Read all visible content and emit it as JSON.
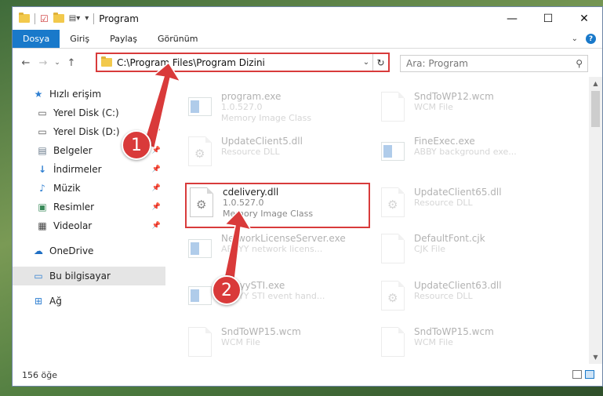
{
  "window": {
    "title": "Program"
  },
  "ribbon": {
    "tabs": [
      "Dosya",
      "Giriş",
      "Paylaş",
      "Görünüm"
    ]
  },
  "address": {
    "path": "C:\\Program Files\\Program Dizini"
  },
  "search": {
    "placeholder": "Ara: Program"
  },
  "sidebar": {
    "items": [
      {
        "label": "Hızlı erişim"
      },
      {
        "label": "Yerel Disk (C:)"
      },
      {
        "label": "Yerel Disk (D:)"
      },
      {
        "label": "Belgeler"
      },
      {
        "label": "İndirmeler"
      },
      {
        "label": "Müzik"
      },
      {
        "label": "Resimler"
      },
      {
        "label": "Videolar"
      },
      {
        "label": "OneDrive"
      },
      {
        "label": "Bu bilgisayar"
      },
      {
        "label": "Ağ"
      }
    ]
  },
  "files": [
    {
      "name": "program.exe",
      "line2": "1.0.527.0",
      "line3": "Memory Image Class"
    },
    {
      "name": "SndToWP12.wcm",
      "line2": "WCM File",
      "line3": ""
    },
    {
      "name": "UpdateClient5.dll",
      "line2": "Resource DLL",
      "line3": ""
    },
    {
      "name": "FineExec.exe",
      "line2": "ABBY background exe...",
      "line3": ""
    },
    {
      "name": "cdelivery.dll",
      "line2": "1.0.527.0",
      "line3": "Memory Image Class"
    },
    {
      "name": "UpdateClient65.dll",
      "line2": "Resource DLL",
      "line3": ""
    },
    {
      "name": "NetworkLicenseServer.exe",
      "line2": "ABBYY network licens...",
      "line3": ""
    },
    {
      "name": "DefaultFont.cjk",
      "line2": "CJK File",
      "line3": ""
    },
    {
      "name": "AbbyySTI.exe",
      "line2": "ABBYY STI event hand...",
      "line3": ""
    },
    {
      "name": "UpdateClient63.dll",
      "line2": "Resource DLL",
      "line3": ""
    },
    {
      "name": "SndToWP15.wcm",
      "line2": "WCM File",
      "line3": ""
    },
    {
      "name": "SndToWP15.wcm",
      "line2": "WCM File",
      "line3": ""
    }
  ],
  "status": {
    "count": "156 öğe"
  },
  "annotations": {
    "step1": "1",
    "step2": "2"
  },
  "colors": {
    "accent": "#1979ca",
    "highlight": "#d83b3b"
  }
}
